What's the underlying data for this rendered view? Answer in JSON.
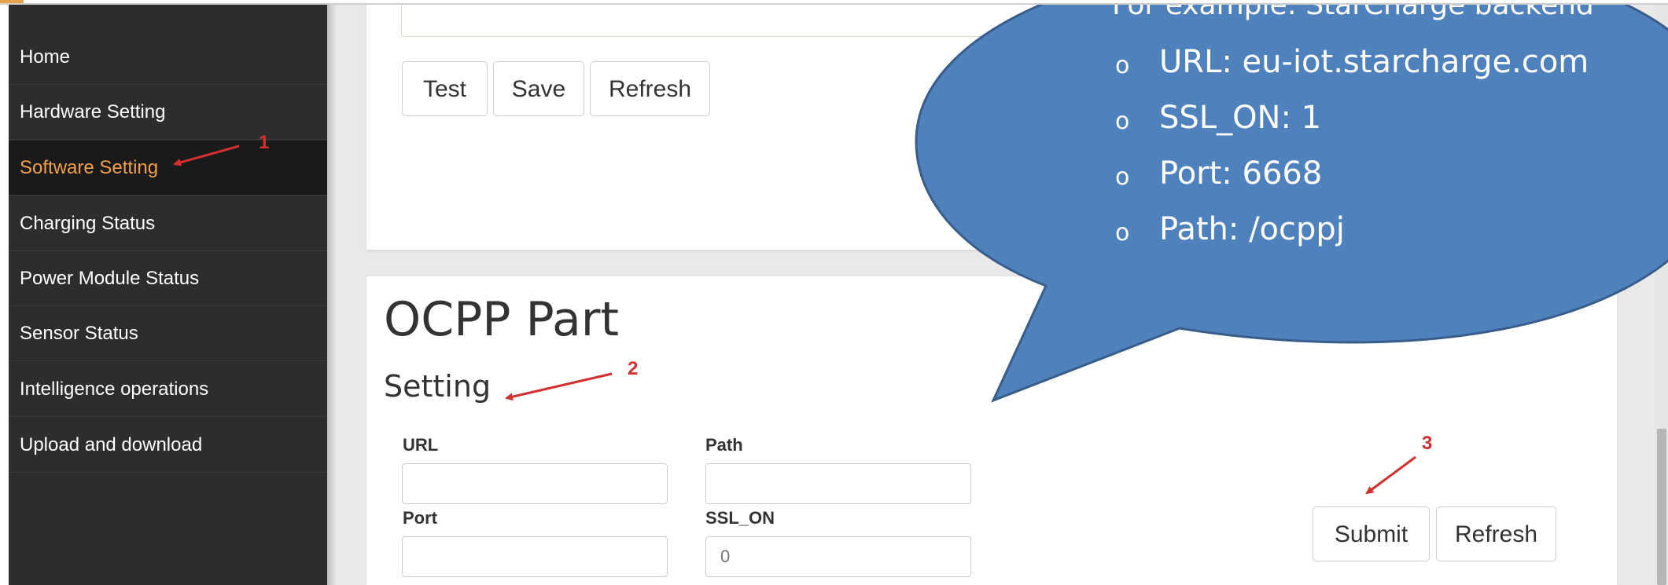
{
  "sidebar": {
    "items": [
      {
        "label": "Home"
      },
      {
        "label": "Hardware Setting"
      },
      {
        "label": "Software Setting",
        "active": true
      },
      {
        "label": "Charging Status"
      },
      {
        "label": "Power Module Status"
      },
      {
        "label": "Sensor Status"
      },
      {
        "label": "Intelligence operations"
      },
      {
        "label": "Upload and download"
      }
    ]
  },
  "top_panel": {
    "buttons": {
      "test": "Test",
      "save": "Save",
      "refresh": "Refresh"
    }
  },
  "ocpp": {
    "title": "OCPP Part",
    "subtitle": "Setting",
    "fields": {
      "url": {
        "label": "URL",
        "value": ""
      },
      "path": {
        "label": "Path",
        "value": ""
      },
      "port": {
        "label": "Port",
        "value": ""
      },
      "ssl_on": {
        "label": "SSL_ON",
        "placeholder": "0"
      }
    },
    "buttons": {
      "submit": "Submit",
      "refresh": "Refresh"
    }
  },
  "callout": {
    "heading": "For example: StarCharge backend",
    "bullet_glyph": "o",
    "items": [
      "URL: eu-iot.starcharge.com",
      "SSL_ON: 1",
      "Port: 6668",
      "Path: /ocppj"
    ]
  },
  "annotations": {
    "n1": "1",
    "n2": "2",
    "n3": "3"
  },
  "colors": {
    "sidebar_bg": "#2d2d2d",
    "sidebar_active_text": "#f0a04b",
    "callout_fill": "#4f81bd",
    "callout_stroke": "#385d8a",
    "annotation_red": "#d32f2f"
  }
}
